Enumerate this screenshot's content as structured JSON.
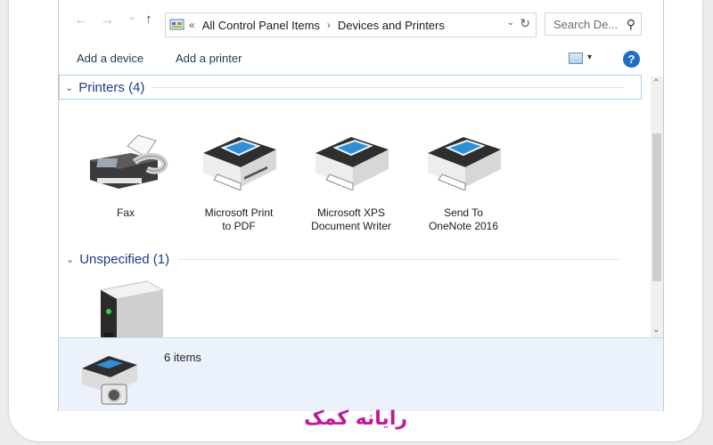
{
  "address": {
    "back_glyph": "←",
    "forward_glyph": "→",
    "recent_glyph": "⌄",
    "up_glyph": "↑",
    "overflow_glyph": "«",
    "crumbs": [
      "All Control Panel Items",
      "Devices and Printers"
    ],
    "crumb_separator": "›",
    "dropdown_glyph": "⌄",
    "refresh_glyph": "↻",
    "search_placeholder": "Search De...",
    "search_glyph": "⚲"
  },
  "toolbar": {
    "add_device": "Add a device",
    "add_printer": "Add a printer",
    "view_dropdown_glyph": "▾",
    "help_glyph": "?"
  },
  "groups": {
    "printers": {
      "title": "Printers (4)",
      "chevron": "⌄",
      "devices": [
        {
          "icon": "fax-icon",
          "line1": "Fax",
          "line2": ""
        },
        {
          "icon": "printer-icon",
          "line1": "Microsoft Print",
          "line2": "to PDF"
        },
        {
          "icon": "printer-icon",
          "line1": "Microsoft XPS",
          "line2": "Document Writer"
        },
        {
          "icon": "printer-icon",
          "line1": "Send To",
          "line2": "OneNote 2016"
        }
      ]
    },
    "unspecified": {
      "title": "Unspecified (1)",
      "chevron": "⌄",
      "devices": [
        {
          "icon": "server-tower-icon",
          "line1": "",
          "line2": ""
        }
      ]
    }
  },
  "scrollbar": {
    "up_glyph": "⌃",
    "down_glyph": "⌄"
  },
  "details": {
    "count": "6 items",
    "icon": "devices-printers-camera-icon"
  },
  "watermark": {
    "text": "رایانه کمک",
    "color": "#c2179a"
  },
  "colors": {
    "group_header": "#1e3a8a",
    "details_pane": "#ebf2fb",
    "help_button": "#1f6bc9",
    "link_text": "#1e3957"
  }
}
